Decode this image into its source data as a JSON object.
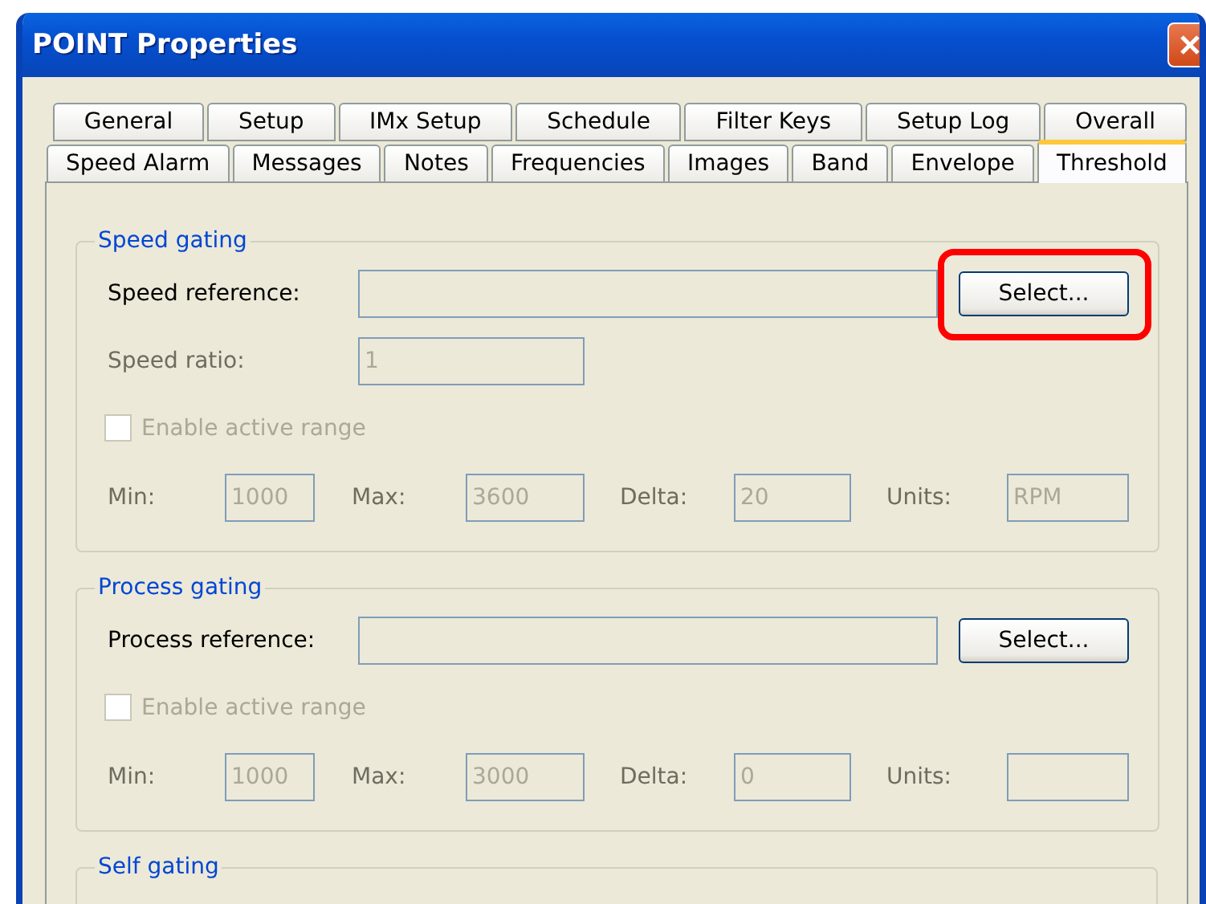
{
  "window": {
    "title": "POINT Properties"
  },
  "tab_rows": [
    {
      "tabs": [
        {
          "label": "General",
          "selected": false
        },
        {
          "label": "Setup",
          "selected": false
        },
        {
          "label": "IMx Setup",
          "selected": false
        },
        {
          "label": "Schedule",
          "selected": false
        },
        {
          "label": "Filter Keys",
          "selected": false
        },
        {
          "label": "Setup Log",
          "selected": false
        },
        {
          "label": "Overall",
          "selected": false
        }
      ]
    },
    {
      "tabs": [
        {
          "label": "Speed Alarm",
          "selected": false
        },
        {
          "label": "Messages",
          "selected": false
        },
        {
          "label": "Notes",
          "selected": false
        },
        {
          "label": "Frequencies",
          "selected": false
        },
        {
          "label": "Images",
          "selected": false
        },
        {
          "label": "Band",
          "selected": false
        },
        {
          "label": "Envelope",
          "selected": false
        },
        {
          "label": "Threshold",
          "selected": true
        }
      ]
    }
  ],
  "groups": [
    {
      "title": "Speed gating",
      "reference": {
        "label": "Speed reference:",
        "button": "Select...",
        "highlighted": true
      },
      "ratio": {
        "label": "Speed ratio:",
        "value": "1",
        "disabled": true
      },
      "checkbox": {
        "label": "Enable active range",
        "checked": false,
        "disabled": true
      },
      "range": [
        {
          "label": "Min:",
          "value": "1000",
          "disabled": true
        },
        {
          "label": "Max:",
          "value": "3600",
          "disabled": true
        },
        {
          "label": "Delta:",
          "value": "20",
          "disabled": true
        },
        {
          "label": "Units:",
          "value": "RPM",
          "disabled": true
        }
      ]
    },
    {
      "title": "Process gating",
      "reference": {
        "label": "Process reference:",
        "button": "Select...",
        "highlighted": false
      },
      "checkbox": {
        "label": "Enable active range",
        "checked": false,
        "disabled": true
      },
      "range": [
        {
          "label": "Min:",
          "value": "1000",
          "disabled": true
        },
        {
          "label": "Max:",
          "value": "3000",
          "disabled": true
        },
        {
          "label": "Delta:",
          "value": "0",
          "disabled": true
        },
        {
          "label": "Units:",
          "disabled": true
        }
      ]
    },
    {
      "title": "Self gating"
    }
  ]
}
